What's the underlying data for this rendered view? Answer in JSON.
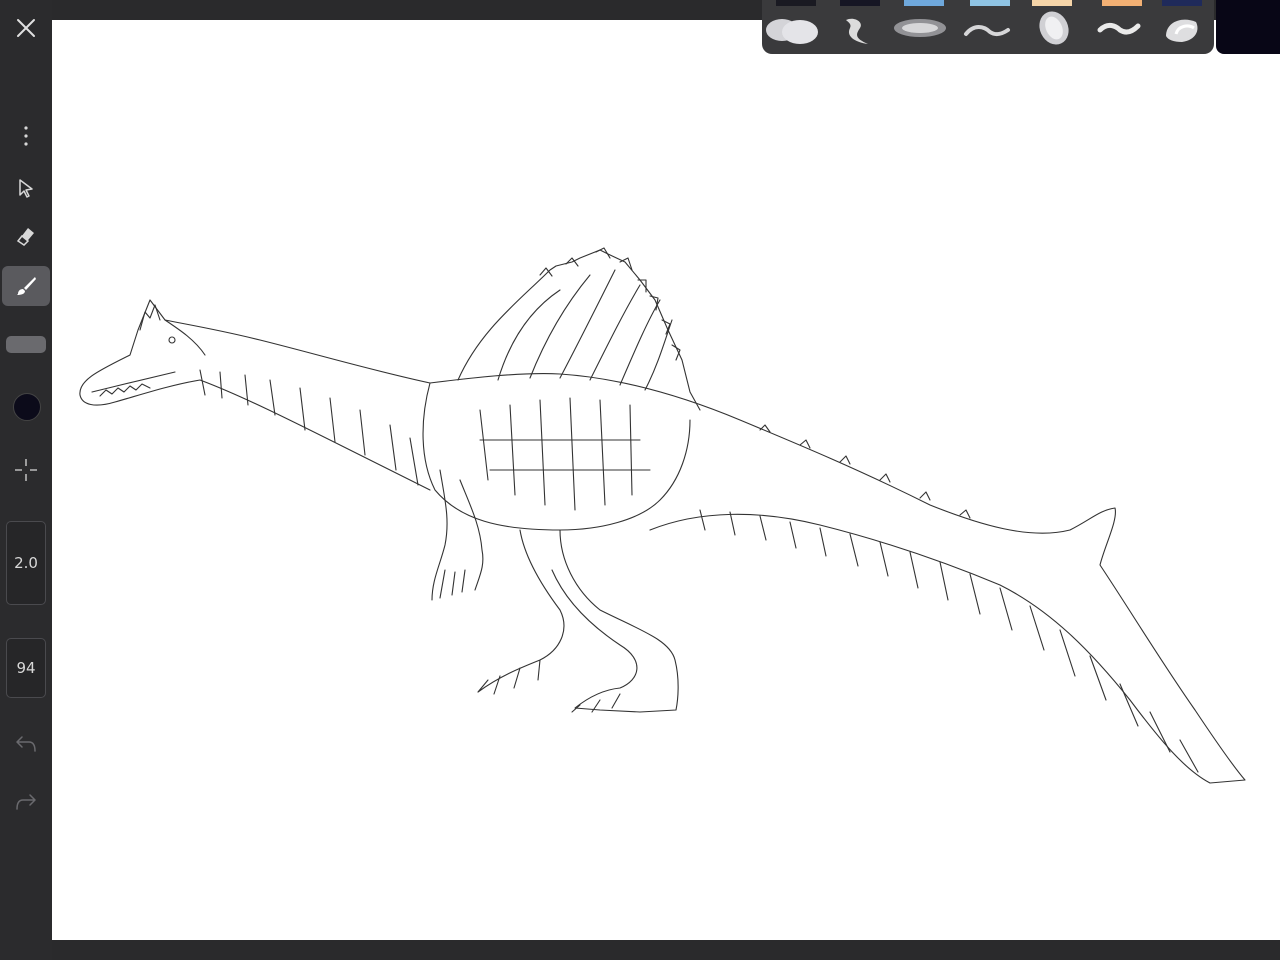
{
  "toolbar": {
    "close_icon": "close-icon",
    "more_icon": "more-vertical-icon",
    "select_icon": "cursor-arrow-icon",
    "eraser_icon": "eraser-icon",
    "brush_icon": "brush-icon",
    "transform_icon": "crosshair-icon",
    "brush_size": "2.0",
    "opacity": "94",
    "undo_icon": "undo-icon",
    "redo_icon": "redo-icon",
    "current_color": "#0c0b1a"
  },
  "palette": {
    "swatches": [
      "#1a1a22",
      "#161624",
      "#6fa8dc",
      "#8fc3e3",
      "#f5d4a8",
      "#f2b074",
      "#1f2a5a"
    ],
    "brushes": [
      "cloud-brush-icon",
      "smudge-brush-icon",
      "spray-brush-icon",
      "ink-brush-icon",
      "airbrush-icon",
      "wave-brush-icon",
      "soft-blend-brush-icon"
    ],
    "current_color": "#080616"
  },
  "canvas": {
    "drawing": "spinosaurus-sketch"
  }
}
